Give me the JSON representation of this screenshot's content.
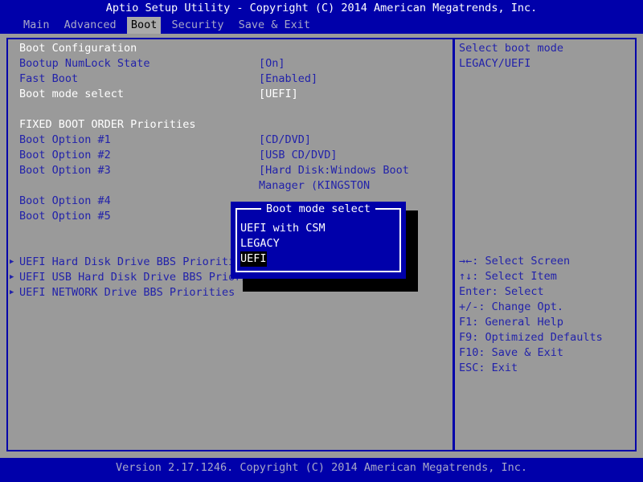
{
  "titlebar": {
    "text": "Aptio Setup Utility - Copyright (C) 2014 American Megatrends, Inc."
  },
  "menubar": {
    "items": [
      {
        "label": "Main",
        "active": false
      },
      {
        "label": "Advanced",
        "active": false
      },
      {
        "label": "Boot",
        "active": true
      },
      {
        "label": "Security",
        "active": false
      },
      {
        "label": "Save & Exit",
        "active": false
      }
    ]
  },
  "main": {
    "section1_title": "Boot Configuration",
    "settings": [
      {
        "label": "Bootup NumLock State",
        "value": "[On]"
      },
      {
        "label": "Fast Boot",
        "value": "[Enabled]"
      },
      {
        "label": "Boot mode select",
        "value": "[UEFI]"
      }
    ],
    "section2_title": "FIXED BOOT ORDER Priorities",
    "boot_options": [
      {
        "label": "Boot Option #1",
        "value": "[CD/DVD]",
        "value2": ""
      },
      {
        "label": "Boot Option #2",
        "value": "[USB CD/DVD]",
        "value2": ""
      },
      {
        "label": "Boot Option #3",
        "value": "[Hard Disk:Windows Boot",
        "value2": "Manager (KINGSTON"
      },
      {
        "label": "Boot Option #4",
        "value": "",
        "value2": ""
      },
      {
        "label": "Boot Option #5",
        "value": "",
        "value2": ""
      }
    ],
    "bbs_items": [
      {
        "marker": "▶",
        "label": "UEFI Hard Disk Drive BBS Priorities"
      },
      {
        "marker": "▶",
        "label": "UEFI USB Hard Disk Drive BBS Priorities"
      },
      {
        "marker": "▶",
        "label": "UEFI NETWORK Drive BBS Priorities"
      }
    ]
  },
  "help": {
    "description": [
      "Select boot mode",
      "LEGACY/UEFI"
    ],
    "keys": [
      "→←: Select Screen",
      "↑↓: Select Item",
      "Enter: Select",
      "+/-: Change Opt.",
      "F1: General Help",
      "F9: Optimized Defaults",
      "F10: Save & Exit",
      "ESC: Exit"
    ]
  },
  "dialog": {
    "title": "Boot mode select",
    "options": [
      {
        "label": "UEFI with CSM",
        "selected": false
      },
      {
        "label": "LEGACY",
        "selected": false
      },
      {
        "label": "UEFI",
        "selected": true
      }
    ]
  },
  "footer": {
    "text": "Version 2.17.1246. Copyright (C) 2014 American Megatrends, Inc."
  }
}
